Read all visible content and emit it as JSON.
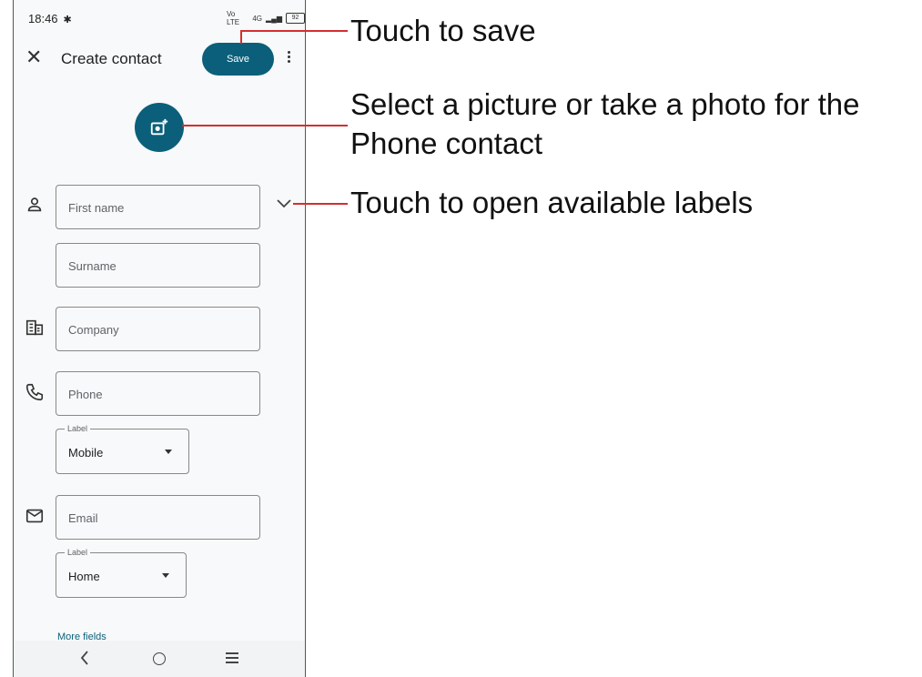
{
  "status_bar": {
    "time": "18:46",
    "battery": "92",
    "network": "Vo LTE",
    "signal": "4G"
  },
  "header": {
    "title": "Create contact",
    "save_label": "Save"
  },
  "form": {
    "first_name_placeholder": "First name",
    "surname_placeholder": "Surname",
    "company_placeholder": "Company",
    "phone_placeholder": "Phone",
    "phone_label_legend": "Label",
    "phone_label_value": "Mobile",
    "email_placeholder": "Email",
    "email_label_legend": "Label",
    "email_label_value": "Home",
    "more_fields": "More fields"
  },
  "annotations": {
    "save": "Touch to save",
    "photo_line1": "Select a picture or take a photo for the",
    "photo_line2": "Phone contact",
    "labels": "Touch to open available labels"
  },
  "colors": {
    "accent": "#0b5f7a",
    "callout_line": "#d32f2f"
  },
  "icons": [
    "close-icon",
    "more-vert-icon",
    "add-photo-icon",
    "person-icon",
    "company-icon",
    "phone-icon",
    "email-icon",
    "chevron-down-icon",
    "back-icon",
    "home-icon",
    "recents-icon"
  ]
}
